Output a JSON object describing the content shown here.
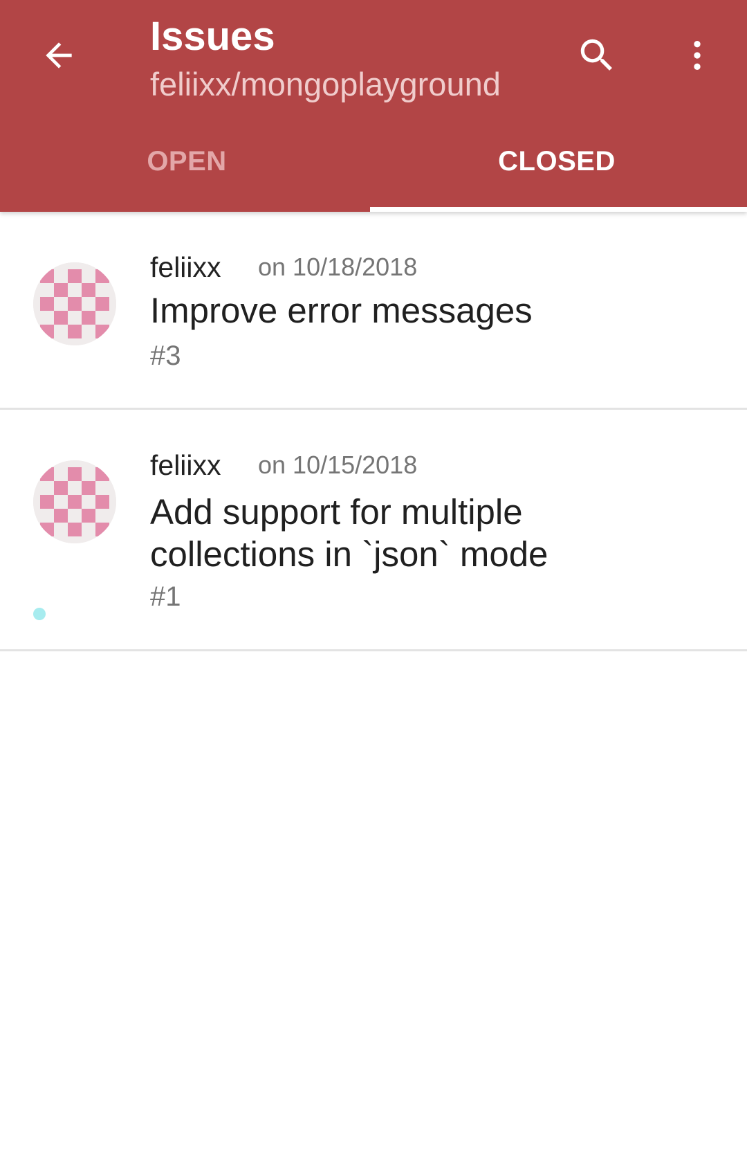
{
  "header": {
    "title": "Issues",
    "subtitle": "feliixx/mongoplayground",
    "background_color": "#b24546",
    "icons": {
      "back": "arrow-back-icon",
      "search": "search-icon",
      "more": "more-vertical-icon"
    }
  },
  "tabs": [
    {
      "label": "OPEN",
      "selected": false
    },
    {
      "label": "CLOSED",
      "selected": true
    }
  ],
  "issues": [
    {
      "author": "feliixx",
      "date": "on 10/18/2018",
      "title": "Improve error messages",
      "number": "#3",
      "avatar_icon": "checkered-avatar-icon",
      "avatar_color": "#e38cab"
    },
    {
      "author": "feliixx",
      "date": "on 10/15/2018",
      "title": "Add support for multiple collections in `json` mode",
      "number": "#1",
      "avatar_icon": "checkered-avatar-icon",
      "avatar_color": "#e38cab",
      "indicator_color": "#a7ecef"
    }
  ]
}
